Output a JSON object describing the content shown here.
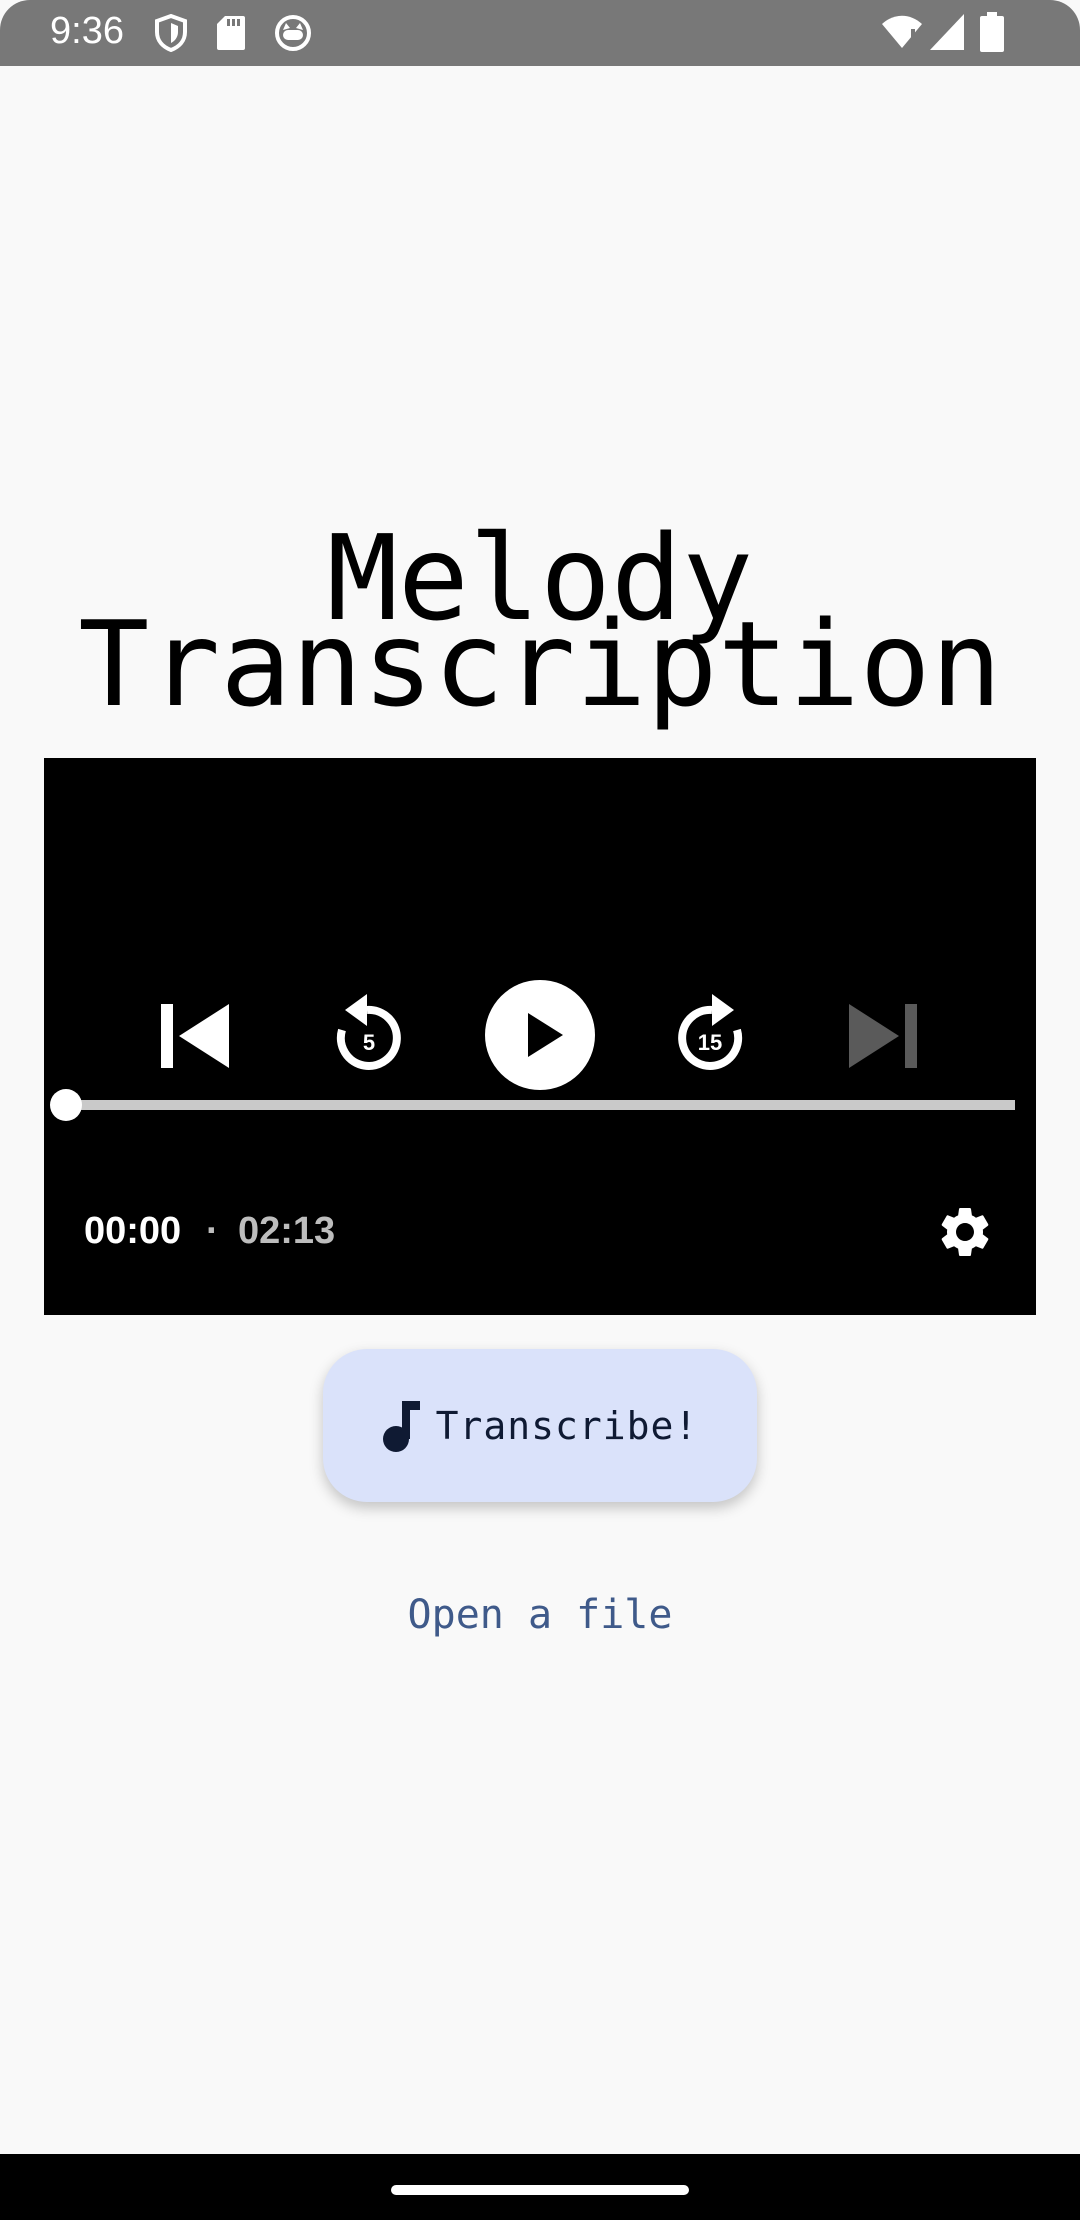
{
  "status_bar": {
    "time": "9:36",
    "icons": [
      "shield-icon",
      "sd-card-icon",
      "cat-face-icon",
      "wifi-alert-icon",
      "signal-icon",
      "battery-icon"
    ]
  },
  "title": {
    "line1": "Melody",
    "line2": "Transcription"
  },
  "player": {
    "current_time": "00:00",
    "separator": "·",
    "total_time": "02:13",
    "progress": 0,
    "rewind_seconds": "5",
    "forward_seconds": "15",
    "icons": [
      "skip-previous-icon",
      "rewind-5-icon",
      "play-icon",
      "forward-15-icon",
      "skip-next-icon",
      "settings-gear-icon"
    ]
  },
  "actions": {
    "transcribe_label": "Transcribe!",
    "transcribe_icon": "music-note-icon",
    "open_file_label": "Open a file"
  },
  "colors": {
    "background": "#f9f9f9",
    "status_bar": "#787878",
    "button_bg": "#dae2fa",
    "link": "#3f5a8a"
  }
}
